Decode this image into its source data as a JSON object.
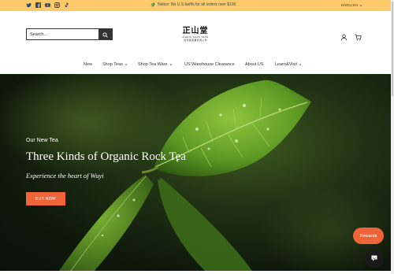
{
  "announcement": {
    "notice": "Notice: No U.S tariffs for all orders over $100",
    "language": "ENGLISH",
    "social_icons": [
      "twitter-icon",
      "facebook-icon",
      "youtube-icon",
      "instagram-icon",
      "tiktok-icon"
    ]
  },
  "header": {
    "search_placeholder": "Search...",
    "logo_mark": "正山堂",
    "logo_sub_1": "ZHENG SHAN TANG",
    "logo_sub_2": "武夷星茶業有限公司"
  },
  "nav": {
    "items": [
      {
        "label": "New",
        "has_dropdown": false
      },
      {
        "label": "Shop Teas",
        "has_dropdown": true
      },
      {
        "label": "Shop Tea Ware",
        "has_dropdown": true
      },
      {
        "label": "US Warehouse Clearance",
        "has_dropdown": false
      },
      {
        "label": "About US",
        "has_dropdown": false
      },
      {
        "label": "Learn&Visit",
        "has_dropdown": true
      }
    ]
  },
  "hero": {
    "kicker": "Our New Tea",
    "title": "Three Kinds of Organic Rock Tea",
    "tagline": "Experience the heart of Wuyi",
    "cta": "BUY NOW"
  },
  "widgets": {
    "rewards": "Rewards"
  },
  "colors": {
    "announcement_bg": "#fcc96b",
    "accent": "#f0643a",
    "dark": "#1a1a1a"
  }
}
